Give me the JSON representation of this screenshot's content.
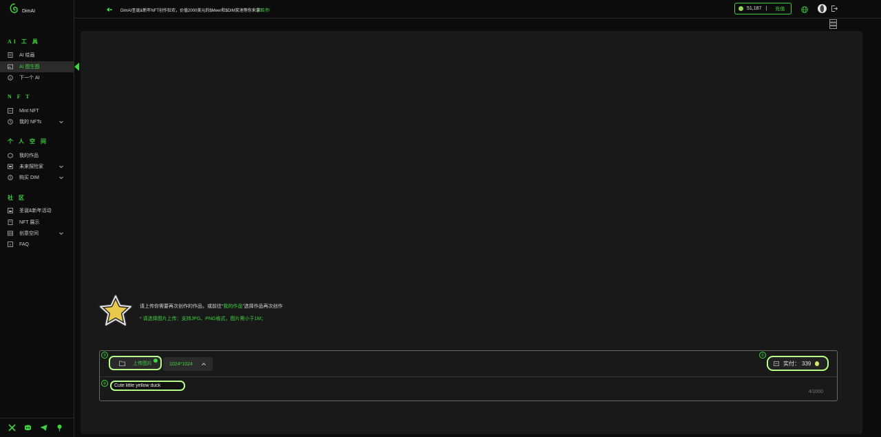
{
  "app": {
    "logo_text": "DimAI"
  },
  "sidebar": {
    "sections": [
      {
        "title": "AI 工 具"
      },
      {
        "title": "N F T"
      },
      {
        "title": "个 人 空 间"
      },
      {
        "title": "社 区"
      }
    ],
    "items": [
      {
        "label": "AI 绘画",
        "icon": "document-icon"
      },
      {
        "label": "AI 图生图",
        "icon": "image-icon",
        "active": true
      },
      {
        "label": "下一个 AI",
        "icon": "info-icon"
      },
      {
        "label": "Mint NFT",
        "icon": "mint-icon"
      },
      {
        "label": "我的 NFTs",
        "icon": "clock-icon",
        "expandable": true
      },
      {
        "label": "我的作品",
        "icon": "cube-icon"
      },
      {
        "label": "未来探险家",
        "icon": "badge-icon",
        "expandable": true
      },
      {
        "label": "购买 DIM",
        "icon": "coin-icon",
        "expandable": true
      },
      {
        "label": "圣诞&新年活动",
        "icon": "gift-icon"
      },
      {
        "label": "NFT 展示",
        "icon": "gallery-icon"
      },
      {
        "label": "创意空间",
        "icon": "space-icon",
        "expandable": true
      },
      {
        "label": "FAQ",
        "icon": "question-icon"
      }
    ],
    "social": [
      "x-icon",
      "discord-icon",
      "telegram-icon",
      "medium-icon"
    ]
  },
  "topbar": {
    "announcement": "DimAI圣诞&新年NFT创作狂欢，价值2000美元的$Meer和$DIM奖池等你来拿！",
    "announcement_link": "点击参!",
    "balance": "51,187",
    "balance_sep": "|",
    "recharge_label": "充值"
  },
  "main": {
    "hint_prefix": "请上传你需要再次创作的作品，或前往“",
    "hint_link": "我的作品",
    "hint_suffix": "”选择作品再次创作",
    "hint_requirement": "* 请选择图片上传：支持JPG、PNG格式，图片需小于1M；",
    "badges": {
      "upload": "③",
      "prompt": "④",
      "pay": "⑤"
    },
    "upload_label": "上传图片",
    "size_value": "1024*1024",
    "pay_label": "实付：",
    "pay_amount": "339",
    "prompt_value": "Cute little yellow duck",
    "char_counter": "4/1000"
  },
  "colors": {
    "accent": "#3fd43f",
    "highlight_border": "#b6ff8a",
    "panel": "#191919",
    "background": "#0c0c0c"
  }
}
